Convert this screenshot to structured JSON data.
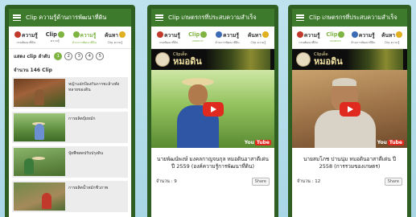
{
  "screens": [
    {
      "title": "Clip ความรู้ด้านการพัฒนาที่ดิน",
      "nav": [
        {
          "main": "ความรู้",
          "sub": "กรมพัฒนาที่ดิน"
        },
        {
          "main": "Clip",
          "sub": "ความรู้"
        },
        {
          "main": "ความรู้",
          "sub": "ด้านการพัฒนาที่ดิน"
        },
        {
          "main": "ค้นหา",
          "sub": "Clip ความรู้"
        }
      ],
      "pager_label": "แสดง clip ลำดับ",
      "pages": [
        "1",
        "2",
        "3",
        "4",
        "5"
      ],
      "count": "จำนวน 146 Clip",
      "clips": [
        {
          "title": "หญ้าแฝกป้องกันการชะล้างพังทลายของดิน"
        },
        {
          "title": "การผลิตปุ๋ยหมัก"
        },
        {
          "title": "ปุ๋ยพืชสดปรับปรุงดิน"
        },
        {
          "title": "การผลิตน้ำหมักชีวภาพ"
        }
      ]
    },
    {
      "title": "Clip เกษตรกรที่ประสบความสำเร็จ",
      "nav": [
        {
          "main": "ความรู้",
          "sub": "กรมพัฒนาที่ดิน"
        },
        {
          "main": "Clip",
          "sub": "เกษตรกร"
        },
        {
          "main": "ความรู้",
          "sub": "ด้านการพัฒนาที่ดิน"
        },
        {
          "main": "ค้นหา",
          "sub": "Clip ความรู้"
        }
      ],
      "logo_small": "Clipเด็ด",
      "logo_big": "หมอดิน",
      "video_brand": "You",
      "video_brand2": "Tube",
      "caption": "นายพัฒน์พงษ์ มงคลกาญจนกุล หมอดินอาสาดีเด่น ปี 2559 (องค์ความรู้การพัฒนาที่ดิน)",
      "views": "จำนวน : 9",
      "share": "Share"
    },
    {
      "title": "Clip เกษตรกรที่ประสบความสำเร็จ",
      "nav": [
        {
          "main": "ความรู้",
          "sub": "กรมพัฒนาที่ดิน"
        },
        {
          "main": "Clip",
          "sub": "เกษตรกร"
        },
        {
          "main": "ความรู้",
          "sub": "ด้านการพัฒนาที่ดิน"
        },
        {
          "main": "ค้นหา",
          "sub": "Clip ความรู้"
        }
      ],
      "logo_small": "Clipเด็ด",
      "logo_big": "หมอดิน",
      "video_brand": "You",
      "video_brand2": "Tube",
      "caption": "นายสมโภช ปานนุ่ม หมอดินอาสาดีเด่น ปี 2558 (การรวมของเกษตร)",
      "views": "จำนวน : 12",
      "share": "Share"
    }
  ]
}
